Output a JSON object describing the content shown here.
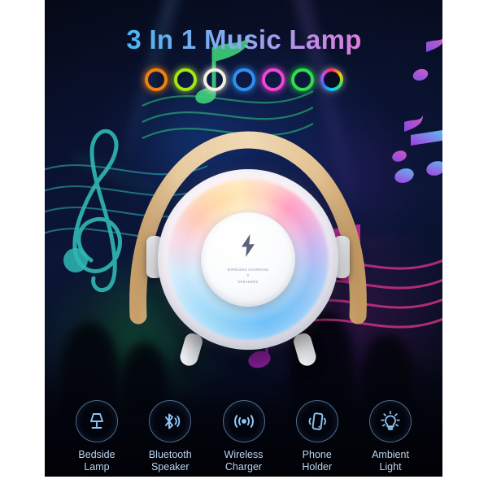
{
  "poster": {
    "headline": "3 In 1 Music Lamp",
    "headline_gradient_from": "#18c8f5",
    "headline_gradient_to": "#f871d8",
    "background_theme": "dark concert stage with blue and purple lighting"
  },
  "color_rings": {
    "name": "rgb-color-modes",
    "count": 7,
    "items": [
      {
        "name": "orange",
        "color": "#f2800f"
      },
      {
        "name": "lime-green",
        "color": "#a6e612"
      },
      {
        "name": "warm-white",
        "color": "#f5f0de"
      },
      {
        "name": "blue",
        "color": "#2f8ef0"
      },
      {
        "name": "magenta",
        "color": "#ef46d6"
      },
      {
        "name": "green",
        "color": "#2ee04a"
      },
      {
        "name": "rainbow",
        "color": "rainbow-gradient"
      }
    ]
  },
  "product": {
    "name": "3-in-1 music lamp with wireless charger",
    "handle_color": "#dcb782",
    "body_color": "#ffffff",
    "pad": {
      "icon": "lightning-bolt-icon",
      "line1": "WIRELESS CHARGING",
      "line2": "X",
      "line3": "SPEAKERS"
    }
  },
  "features": {
    "items": [
      {
        "icon": "table-lamp-icon",
        "line1": "Bedside",
        "line2": "Lamp"
      },
      {
        "icon": "bluetooth-icon",
        "line1": "Bluetooth",
        "line2": "Speaker"
      },
      {
        "icon": "wireless-signal-icon",
        "line1": "Wireless",
        "line2": "Charger"
      },
      {
        "icon": "phone-vibrate-icon",
        "line1": "Phone",
        "line2": "Holder"
      },
      {
        "icon": "lightbulb-icon",
        "line1": "Ambient",
        "line2": "Light"
      }
    ],
    "label_color": "#bcd6f2",
    "icon_color": "#8ec5f5"
  },
  "decor": {
    "treble_clef_color": "#2fb8b4",
    "note_colors": [
      "#57c8f7",
      "#b464e8",
      "#e0479e"
    ],
    "staff_color": "#e0368f"
  }
}
